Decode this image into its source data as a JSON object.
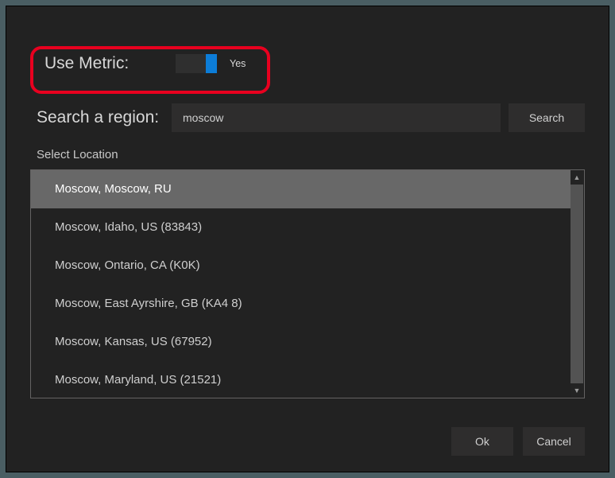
{
  "metric": {
    "label": "Use Metric:",
    "state": "Yes",
    "on": true
  },
  "search": {
    "label": "Search a region:",
    "value": "moscow",
    "button": "Search"
  },
  "selectLocationLabel": "Select Location",
  "locations": [
    "Moscow, Moscow, RU",
    "Moscow, Idaho, US (83843)",
    "Moscow, Ontario, CA (K0K)",
    "Moscow, East Ayrshire, GB (KA4 8)",
    "Moscow, Kansas, US (67952)",
    "Moscow, Maryland, US (21521)"
  ],
  "selectedIndex": 0,
  "buttons": {
    "ok": "Ok",
    "cancel": "Cancel"
  }
}
